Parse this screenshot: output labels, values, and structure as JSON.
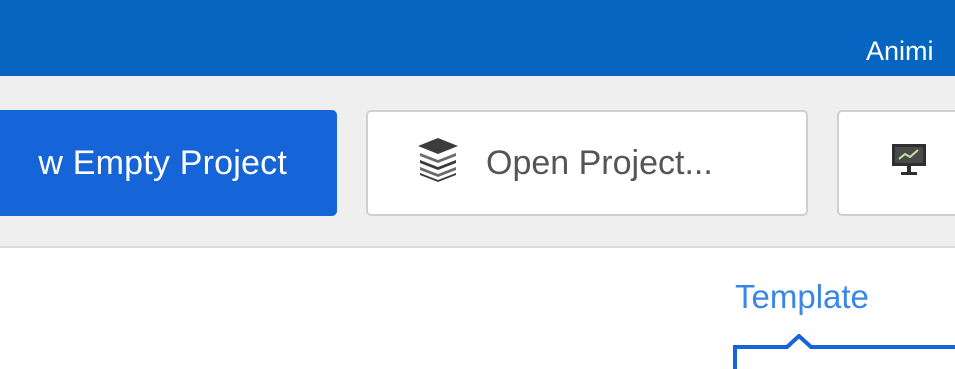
{
  "window": {
    "title": "Animi"
  },
  "toolbar": {
    "new_project_label": "w Empty Project",
    "open_project_label": "Open Project...",
    "open_project_icon": "stack-layers-icon",
    "third_button_icon": "presentation-screen-icon"
  },
  "content": {
    "active_tab_label": "Template"
  },
  "colors": {
    "titlebar": "#0565c0",
    "primary_button": "#1565d8",
    "toolbar_bg": "#efefef",
    "tab_accent": "#1565d8",
    "tab_label": "#3a86e6"
  }
}
